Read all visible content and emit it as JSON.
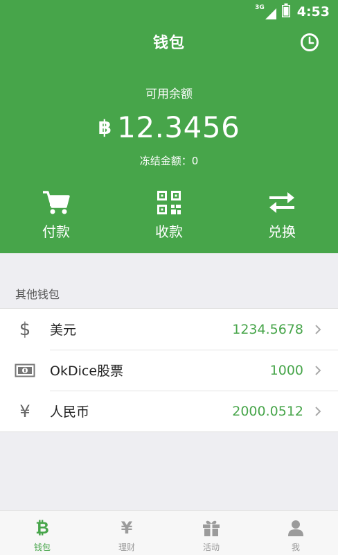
{
  "status_bar": {
    "network": "3G",
    "time": "4:53"
  },
  "header": {
    "title": "钱包",
    "balance_label": "可用余额",
    "currency_symbol": "฿",
    "balance": "12.3456",
    "frozen": "冻结金额：0",
    "history_icon": "clock-icon"
  },
  "actions": [
    {
      "label": "付款",
      "icon": "cart-icon"
    },
    {
      "label": "收款",
      "icon": "qr-code-icon"
    },
    {
      "label": "兑换",
      "icon": "exchange-icon"
    }
  ],
  "other_wallets": {
    "label": "其他钱包",
    "items": [
      {
        "icon": "dollar-icon",
        "symbol": "$",
        "name": "美元",
        "value": "1234.5678"
      },
      {
        "icon": "banknote-icon",
        "symbol": "",
        "name": "OkDice股票",
        "value": "1000"
      },
      {
        "icon": "yen-icon",
        "symbol": "¥",
        "name": "人民币",
        "value": "2000.0512"
      }
    ]
  },
  "tabs": [
    {
      "label": "钱包",
      "icon": "bitcoin-icon",
      "glyph": "₿",
      "active": true
    },
    {
      "label": "理财",
      "icon": "yen-icon",
      "glyph": "¥",
      "active": false
    },
    {
      "label": "活动",
      "icon": "gift-icon",
      "glyph": "",
      "active": false
    },
    {
      "label": "我",
      "icon": "user-icon",
      "glyph": "",
      "active": false
    }
  ],
  "colors": {
    "primary": "#47a54a",
    "background": "#eeeef2",
    "text_muted": "#9b9b9b"
  }
}
